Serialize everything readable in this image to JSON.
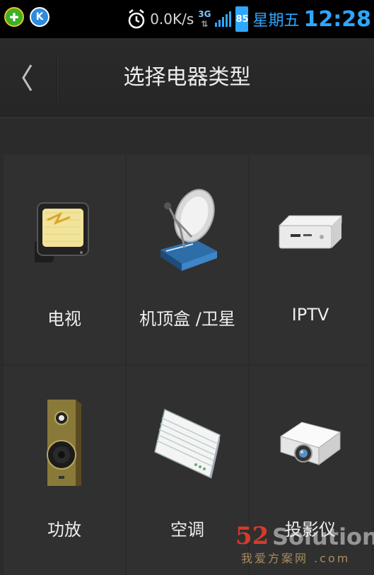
{
  "status_bar": {
    "net_speed": "0.0K/s",
    "network_type": "3G",
    "battery": "85",
    "weekday": "星期五",
    "time": "12:28"
  },
  "header": {
    "title": "选择电器类型",
    "back_glyph": "〈"
  },
  "devices": [
    {
      "label": "电视",
      "icon": "tv-icon"
    },
    {
      "label": "机顶盒 /卫星",
      "icon": "satellite-dish-icon"
    },
    {
      "label": "IPTV",
      "icon": "iptv-box-icon"
    },
    {
      "label": "功放",
      "icon": "speaker-icon"
    },
    {
      "label": "空调",
      "icon": "air-conditioner-icon"
    },
    {
      "label": "投影仪",
      "icon": "projector-icon"
    }
  ],
  "watermark": {
    "number": "52",
    "word": "Solution",
    "subtitle": "我爱方案网 .com"
  },
  "colors": {
    "accent": "#2ea7ff",
    "background": "#2b2b2b",
    "tile": "#303030"
  }
}
